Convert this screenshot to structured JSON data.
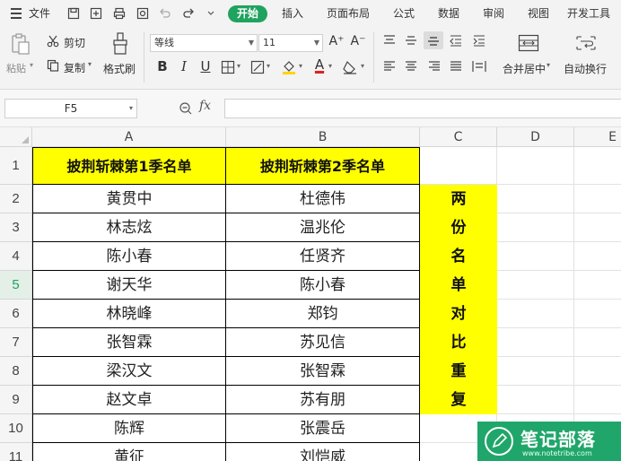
{
  "menu": {
    "file_label": "文件",
    "tabs": [
      {
        "label": "开始",
        "active": true
      },
      {
        "label": "插入",
        "active": false
      },
      {
        "label": "页面布局",
        "active": false
      },
      {
        "label": "公式",
        "active": false
      },
      {
        "label": "数据",
        "active": false
      },
      {
        "label": "审阅",
        "active": false
      },
      {
        "label": "视图",
        "active": false
      },
      {
        "label": "开发工具",
        "active": false
      }
    ],
    "quick_access_icons": [
      "save-icon",
      "export-icon",
      "print-icon",
      "print-preview-icon",
      "undo-icon",
      "redo-icon",
      "customize-icon"
    ]
  },
  "ribbon": {
    "paste_label": "粘贴",
    "cut_label": "剪切",
    "copy_label": "复制",
    "format_painter_label": "格式刷",
    "font_name": "等线",
    "font_size": "11",
    "merge_center_label": "合并居中",
    "wrap_text_label": "自动换行",
    "bold_glyph": "B",
    "italic_glyph": "I",
    "underline_glyph": "U",
    "grow_font_glyph": "A⁺",
    "shrink_font_glyph": "A⁻",
    "font_color_glyph": "A"
  },
  "formula_bar": {
    "name_box": "F5",
    "fx_label": "fx",
    "formula": ""
  },
  "sheet": {
    "columns": [
      "A",
      "B",
      "C",
      "D",
      "E"
    ],
    "rows": [
      "1",
      "2",
      "3",
      "4",
      "5",
      "6",
      "7",
      "8",
      "9",
      "10",
      "11"
    ],
    "selected_row": "5",
    "header_a": "披荆斩棘第1季名单",
    "header_b": "披荆斩棘第2季名单",
    "col_a": [
      "黄贯中",
      "林志炫",
      "陈小春",
      "谢天华",
      "林晓峰",
      "张智霖",
      "梁汉文",
      "赵文卓",
      "陈辉",
      "黄征"
    ],
    "col_b": [
      "杜德伟",
      "温兆伦",
      "任贤齐",
      "陈小春",
      "郑钧",
      "苏见信",
      "张智霖",
      "苏有朋",
      "张震岳",
      "刘恺威"
    ],
    "col_c": [
      "两",
      "份",
      "名",
      "单",
      "对",
      "比",
      "重",
      "复"
    ]
  },
  "watermark": {
    "title": "笔记部落",
    "url": "www.notetribe.com"
  },
  "colors": {
    "accent": "#1fa35f",
    "highlight": "#ffff00",
    "watermark": "#20a66a"
  }
}
